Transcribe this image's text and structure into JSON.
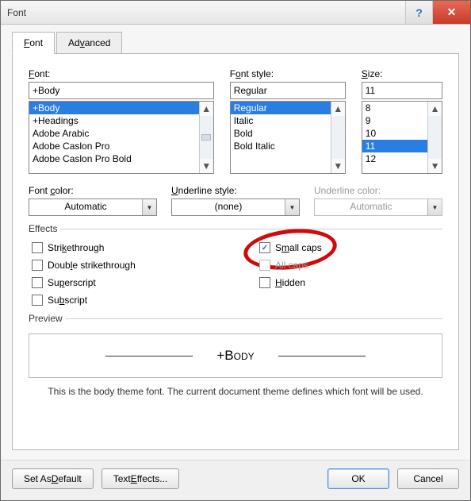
{
  "window": {
    "title": "Font"
  },
  "tabs": [
    {
      "label": "Font",
      "active": true
    },
    {
      "label": "Advanced",
      "active": false
    }
  ],
  "font": {
    "label": "Font:",
    "value": "+Body",
    "options": [
      "+Body",
      "+Headings",
      "Adobe Arabic",
      "Adobe Caslon Pro",
      "Adobe Caslon Pro Bold"
    ],
    "selected": "+Body"
  },
  "style": {
    "label": "Font style:",
    "value": "Regular",
    "options": [
      "Regular",
      "Italic",
      "Bold",
      "Bold Italic"
    ],
    "selected": "Regular"
  },
  "size": {
    "label": "Size:",
    "value": "11",
    "options": [
      "8",
      "9",
      "10",
      "11",
      "12"
    ],
    "selected": "11"
  },
  "color": {
    "label": "Font color:",
    "value": "Automatic"
  },
  "ustyle": {
    "label": "Underline style:",
    "value": "(none)"
  },
  "ucolor": {
    "label": "Underline color:",
    "value": "Automatic",
    "disabled": true
  },
  "effects": {
    "legend": "Effects",
    "strikethrough": {
      "label": "Strikethrough",
      "checked": false
    },
    "dblstrike": {
      "label": "Double strikethrough",
      "checked": false
    },
    "superscript": {
      "label": "Superscript",
      "checked": false
    },
    "subscript": {
      "label": "Subscript",
      "checked": false
    },
    "smallcaps": {
      "label": "Small caps",
      "checked": true,
      "highlighted": true
    },
    "allcaps": {
      "label": "All caps",
      "checked": false,
      "disabled": true
    },
    "hidden": {
      "label": "Hidden",
      "checked": false
    }
  },
  "preview": {
    "legend": "Preview",
    "sample": "+Body"
  },
  "note": "This is the body theme font. The current document theme defines which font will be used.",
  "buttons": {
    "set_default": "Set As Default",
    "text_effects": "Text Effects...",
    "ok": "OK",
    "cancel": "Cancel"
  }
}
